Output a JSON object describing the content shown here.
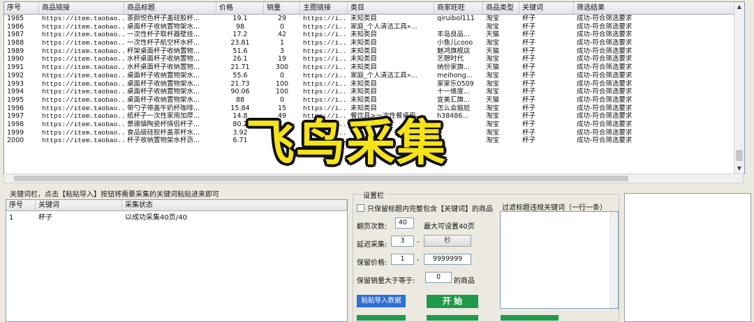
{
  "results": {
    "columns": [
      "序号",
      "商品链接",
      "商品标题",
      "价格",
      "销量",
      "主图链接",
      "类目",
      "商家旺旺",
      "商品类型",
      "关键词",
      "筛选结果"
    ],
    "rows": [
      [
        "1985",
        "https://item.taobao....",
        "茶颜悦色杯子盖硅胶杯...",
        "19.1",
        "29",
        "https://i...",
        "未知类目",
        "qiruibol111",
        "淘宝",
        "杯子",
        "成功-符合筛选要求"
      ],
      [
        "1986",
        "https://item.taobao....",
        "桌面杯子收纳置物架水...",
        "98",
        "0",
        "https://i...",
        "家庭_个人清洁工具»...",
        "",
        "淘宝",
        "杯子",
        "成功-符合筛选要求"
      ],
      [
        "1987",
        "https://item.taobao....",
        "一次性杯子取杯器壁挂...",
        "17.2",
        "42",
        "https://i...",
        "未知类目",
        "丰岛良品...",
        "天猫",
        "杯子",
        "成功-符合筛选要求"
      ],
      [
        "1988",
        "https://item.taobao....",
        "一次性杯子航空杯水杯...",
        "23.81",
        "1",
        "https://i...",
        "未知类目",
        "小鱼儿cooo",
        "淘宝",
        "杯子",
        "成功-符合筛选要求"
      ],
      [
        "1989",
        "https://item.taobao....",
        "杯架桌面杯子收纳置物...",
        "51.6",
        "3",
        "https://i...",
        "未知类目",
        "魅鸿旗舰店",
        "天猫",
        "杯子",
        "成功-符合筛选要求"
      ],
      [
        "1990",
        "https://item.taobao....",
        "水杯桌面杯子收纳置物...",
        "26.1",
        "19",
        "https://i...",
        "未知类目",
        "艺憩时代",
        "淘宝",
        "杯子",
        "成功-符合筛选要求"
      ],
      [
        "1991",
        "https://item.taobao....",
        "水杯桌面杯子收纳置物...",
        "21.71",
        "300",
        "https://i...",
        "未知类目",
        "纳份家旗...",
        "天猫",
        "杯子",
        "成功-符合筛选要求"
      ],
      [
        "1992",
        "https://item.taobao....",
        "桌面杯子收纳置物架水...",
        "55.6",
        "0",
        "https://i...",
        "家庭_个人清洁工具»...",
        "meihong...",
        "淘宝",
        "杯子",
        "成功-符合筛选要求"
      ],
      [
        "1993",
        "https://item.taobao....",
        "桌面杯子收纳置物架水...",
        "21.73",
        "100",
        "https://i...",
        "未知类目",
        "家家乐0509",
        "淘宝",
        "杯子",
        "成功-符合筛选要求"
      ],
      [
        "1994",
        "https://item.taobao....",
        "桌面杯子收纳置物架水...",
        "90.06",
        "100",
        "https://i...",
        "未知类目",
        "十一维度...",
        "淘宝",
        "杯子",
        "成功-符合筛选要求"
      ],
      [
        "1995",
        "https://item.taobao....",
        "桌面杯子收纳置物架水...",
        "88",
        "0",
        "https://i...",
        "未知类目",
        "宜美汇旗...",
        "天猫",
        "杯子",
        "成功-符合筛选要求"
      ],
      [
        "1996",
        "https://item.taobao....",
        "带勺子带盖牛奶杯咖啡...",
        "15.84",
        "15",
        "https://i...",
        "未知类目",
        "怎么会尴尬",
        "淘宝",
        "杯子",
        "成功-符合筛选要求"
      ],
      [
        "1997",
        "https://item.taobao....",
        "纸杯子一次性家用加厚...",
        "14.8",
        "49",
        "https://i...",
        "餐饮具>一次性餐桌用...",
        "h38486...",
        "淘宝",
        "杯子",
        "成功-符合筛选要求"
      ],
      [
        "1998",
        "https://item.taobao....",
        "景德镇陶瓷杯情侣杯子...",
        "80.2",
        "",
        "https://i...",
        "",
        "",
        "淘宝",
        "杯子",
        "成功-符合筛选要求"
      ],
      [
        "1999",
        "https://item.taobao....",
        "食品级硅胶杯盖茶杯水...",
        "3.92",
        "300",
        "https://i...",
        "",
        "",
        "淘宝",
        "杯子",
        "成功-符合筛选要求"
      ],
      [
        "2000",
        "https://item.taobao....",
        "杯子收纳置物架水杯沥...",
        "6.71",
        "1000",
        "https://i...",
        "",
        "",
        "淘宝",
        "杯子",
        "成功-符合筛选要求"
      ]
    ]
  },
  "keyword_panel": {
    "hint": "关键词栏，点击【粘贴导入】按钮将需要采集的关键词粘贴进来即可",
    "columns": [
      "序号",
      "关键词",
      "采集状态"
    ],
    "rows": [
      [
        "1",
        "杯子",
        "以成功采集40页/40"
      ]
    ]
  },
  "settings": {
    "legend": "设置栏",
    "only_keyword_checkbox": "只保留标题内完整包含【关键词】的商品",
    "page_turns_label": "翻页次数:",
    "page_turns_value": "40",
    "page_turns_note": "最大可设置40页",
    "delay_label": "延迟采集:",
    "delay_value": "3",
    "delay_dash": "-",
    "delay_unit_button": "秒",
    "price_label": "保留价格:",
    "price_min": "1",
    "price_dash": "-",
    "price_max": "9999999",
    "sales_label": "保留销量大于等于:",
    "sales_value": "0",
    "sales_suffix": "的商品",
    "paste_button": "粘贴导入数据",
    "start_button": "开 始"
  },
  "filter": {
    "label": "过滤标题违规关键词（一行一条）"
  },
  "watermark": "飞鸟采集",
  "colors": {
    "paste_btn": "#2f6fd6",
    "start_btn": "#1f9a4a",
    "watermark_fill": "#f5e31a"
  }
}
